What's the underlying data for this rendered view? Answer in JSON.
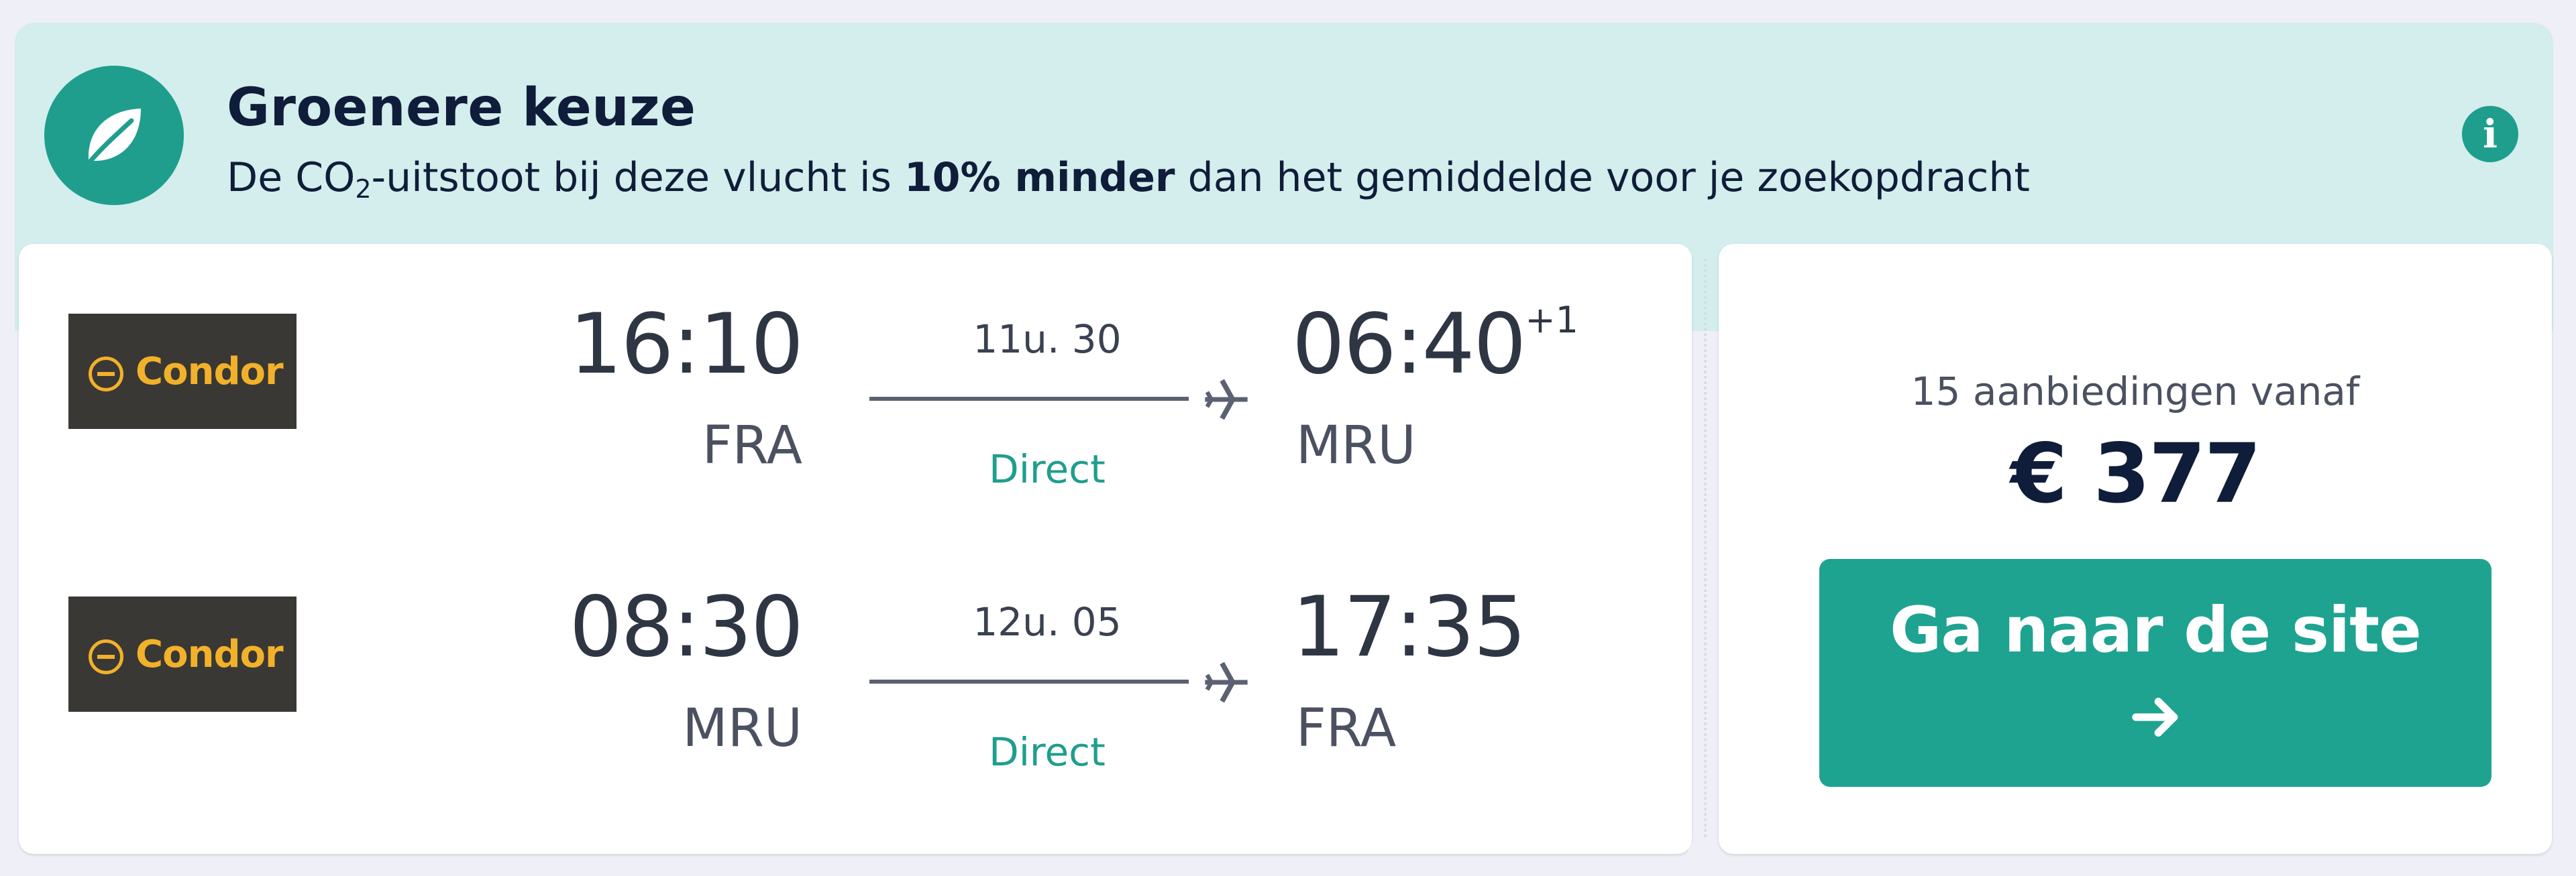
{
  "banner": {
    "title": "Groenere keuze",
    "text_before": "De CO",
    "text_sub": "2",
    "text_middle": "-uitstoot bij deze vlucht is ",
    "text_bold": "10% minder",
    "text_after": " dan het gemiddelde voor je zoekopdracht",
    "icon": "leaf-icon",
    "info_icon": "info-icon",
    "accent_color": "#1f9e8d"
  },
  "legs": [
    {
      "airline": "Condor",
      "departure_time": "16:10",
      "departure_airport": "FRA",
      "duration": "11u. 30",
      "stops": "Direct",
      "arrival_time": "06:40",
      "arrival_day_offset": "+1",
      "arrival_airport": "MRU"
    },
    {
      "airline": "Condor",
      "departure_time": "08:30",
      "departure_airport": "MRU",
      "duration": "12u. 05",
      "stops": "Direct",
      "arrival_time": "17:35",
      "arrival_day_offset": "",
      "arrival_airport": "FRA"
    }
  ],
  "price_panel": {
    "offers_text": "15 aanbiedingen vanaf",
    "price": "€ 377",
    "cta_label": "Ga naar de site",
    "cta_icon": "arrow-right-icon",
    "cta_color": "#1ea390"
  }
}
